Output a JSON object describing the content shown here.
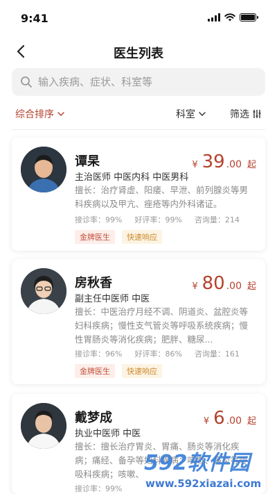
{
  "status": {
    "time": "9:41"
  },
  "nav": {
    "title": "医生列表"
  },
  "search": {
    "placeholder": "输入疾病、症状、科室等"
  },
  "filters": {
    "sort": "综合排序",
    "department": "科室",
    "screen": "筛选"
  },
  "doctors": [
    {
      "name": "谭杲",
      "title": "主治医师 中医内科 中医男科",
      "price_currency": "¥",
      "price_int": "39",
      "price_dec": ".00",
      "price_suffix": "起",
      "desc": "擅长：治疗肾虚、阳痿、早泄、前列腺炎等男科疾病以及甲亢、痤疮等内外科诸证。",
      "stats": [
        "接诊率：99%",
        "好评率：99%",
        "咨询量：214"
      ],
      "tags": [
        "金牌医生",
        "快速响应"
      ]
    },
    {
      "name": "房秋香",
      "title": "副主任中医师 中医",
      "price_currency": "¥",
      "price_int": "80",
      "price_dec": ".00",
      "price_suffix": "起",
      "desc": "擅长：中医治疗月经不调、阴道炎、盆腔炎等妇科疾病；慢性支气管炎等呼吸系统疾病；慢性胃肠炎等消化疾病；肥胖、糖尿...",
      "stats": [
        "接诊率：96%",
        "好评率：86%",
        "咨询量：161"
      ],
      "tags": [
        "金牌医生",
        "快速响应"
      ]
    },
    {
      "name": "戴梦成",
      "title": "执业中医师 中医",
      "price_currency": "¥",
      "price_int": "6",
      "price_dec": ".00",
      "price_suffix": "起",
      "desc": "擅长：擅长治疗胃炎、胃痛、肠炎等消化疾病；痛经、备孕等妇科疾病；咳嗽、鼻炎等呼吸科疾病；咳嗽、",
      "stats": [
        "接诊率：99%"
      ],
      "tags": []
    }
  ],
  "watermark": {
    "brand": "592软件园",
    "url": "www.592xiazai.com"
  }
}
